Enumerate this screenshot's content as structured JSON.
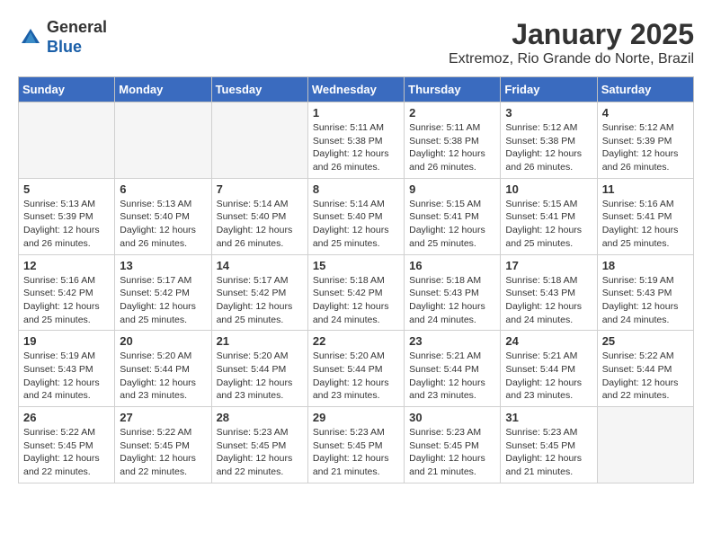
{
  "header": {
    "logo_general": "General",
    "logo_blue": "Blue",
    "month_year": "January 2025",
    "location": "Extremoz, Rio Grande do Norte, Brazil"
  },
  "days_of_week": [
    "Sunday",
    "Monday",
    "Tuesday",
    "Wednesday",
    "Thursday",
    "Friday",
    "Saturday"
  ],
  "weeks": [
    [
      {
        "day": "",
        "info": ""
      },
      {
        "day": "",
        "info": ""
      },
      {
        "day": "",
        "info": ""
      },
      {
        "day": "1",
        "info": "Sunrise: 5:11 AM\nSunset: 5:38 PM\nDaylight: 12 hours\nand 26 minutes."
      },
      {
        "day": "2",
        "info": "Sunrise: 5:11 AM\nSunset: 5:38 PM\nDaylight: 12 hours\nand 26 minutes."
      },
      {
        "day": "3",
        "info": "Sunrise: 5:12 AM\nSunset: 5:38 PM\nDaylight: 12 hours\nand 26 minutes."
      },
      {
        "day": "4",
        "info": "Sunrise: 5:12 AM\nSunset: 5:39 PM\nDaylight: 12 hours\nand 26 minutes."
      }
    ],
    [
      {
        "day": "5",
        "info": "Sunrise: 5:13 AM\nSunset: 5:39 PM\nDaylight: 12 hours\nand 26 minutes."
      },
      {
        "day": "6",
        "info": "Sunrise: 5:13 AM\nSunset: 5:40 PM\nDaylight: 12 hours\nand 26 minutes."
      },
      {
        "day": "7",
        "info": "Sunrise: 5:14 AM\nSunset: 5:40 PM\nDaylight: 12 hours\nand 26 minutes."
      },
      {
        "day": "8",
        "info": "Sunrise: 5:14 AM\nSunset: 5:40 PM\nDaylight: 12 hours\nand 25 minutes."
      },
      {
        "day": "9",
        "info": "Sunrise: 5:15 AM\nSunset: 5:41 PM\nDaylight: 12 hours\nand 25 minutes."
      },
      {
        "day": "10",
        "info": "Sunrise: 5:15 AM\nSunset: 5:41 PM\nDaylight: 12 hours\nand 25 minutes."
      },
      {
        "day": "11",
        "info": "Sunrise: 5:16 AM\nSunset: 5:41 PM\nDaylight: 12 hours\nand 25 minutes."
      }
    ],
    [
      {
        "day": "12",
        "info": "Sunrise: 5:16 AM\nSunset: 5:42 PM\nDaylight: 12 hours\nand 25 minutes."
      },
      {
        "day": "13",
        "info": "Sunrise: 5:17 AM\nSunset: 5:42 PM\nDaylight: 12 hours\nand 25 minutes."
      },
      {
        "day": "14",
        "info": "Sunrise: 5:17 AM\nSunset: 5:42 PM\nDaylight: 12 hours\nand 25 minutes."
      },
      {
        "day": "15",
        "info": "Sunrise: 5:18 AM\nSunset: 5:42 PM\nDaylight: 12 hours\nand 24 minutes."
      },
      {
        "day": "16",
        "info": "Sunrise: 5:18 AM\nSunset: 5:43 PM\nDaylight: 12 hours\nand 24 minutes."
      },
      {
        "day": "17",
        "info": "Sunrise: 5:18 AM\nSunset: 5:43 PM\nDaylight: 12 hours\nand 24 minutes."
      },
      {
        "day": "18",
        "info": "Sunrise: 5:19 AM\nSunset: 5:43 PM\nDaylight: 12 hours\nand 24 minutes."
      }
    ],
    [
      {
        "day": "19",
        "info": "Sunrise: 5:19 AM\nSunset: 5:43 PM\nDaylight: 12 hours\nand 24 minutes."
      },
      {
        "day": "20",
        "info": "Sunrise: 5:20 AM\nSunset: 5:44 PM\nDaylight: 12 hours\nand 23 minutes."
      },
      {
        "day": "21",
        "info": "Sunrise: 5:20 AM\nSunset: 5:44 PM\nDaylight: 12 hours\nand 23 minutes."
      },
      {
        "day": "22",
        "info": "Sunrise: 5:20 AM\nSunset: 5:44 PM\nDaylight: 12 hours\nand 23 minutes."
      },
      {
        "day": "23",
        "info": "Sunrise: 5:21 AM\nSunset: 5:44 PM\nDaylight: 12 hours\nand 23 minutes."
      },
      {
        "day": "24",
        "info": "Sunrise: 5:21 AM\nSunset: 5:44 PM\nDaylight: 12 hours\nand 23 minutes."
      },
      {
        "day": "25",
        "info": "Sunrise: 5:22 AM\nSunset: 5:44 PM\nDaylight: 12 hours\nand 22 minutes."
      }
    ],
    [
      {
        "day": "26",
        "info": "Sunrise: 5:22 AM\nSunset: 5:45 PM\nDaylight: 12 hours\nand 22 minutes."
      },
      {
        "day": "27",
        "info": "Sunrise: 5:22 AM\nSunset: 5:45 PM\nDaylight: 12 hours\nand 22 minutes."
      },
      {
        "day": "28",
        "info": "Sunrise: 5:23 AM\nSunset: 5:45 PM\nDaylight: 12 hours\nand 22 minutes."
      },
      {
        "day": "29",
        "info": "Sunrise: 5:23 AM\nSunset: 5:45 PM\nDaylight: 12 hours\nand 21 minutes."
      },
      {
        "day": "30",
        "info": "Sunrise: 5:23 AM\nSunset: 5:45 PM\nDaylight: 12 hours\nand 21 minutes."
      },
      {
        "day": "31",
        "info": "Sunrise: 5:23 AM\nSunset: 5:45 PM\nDaylight: 12 hours\nand 21 minutes."
      },
      {
        "day": "",
        "info": ""
      }
    ]
  ]
}
